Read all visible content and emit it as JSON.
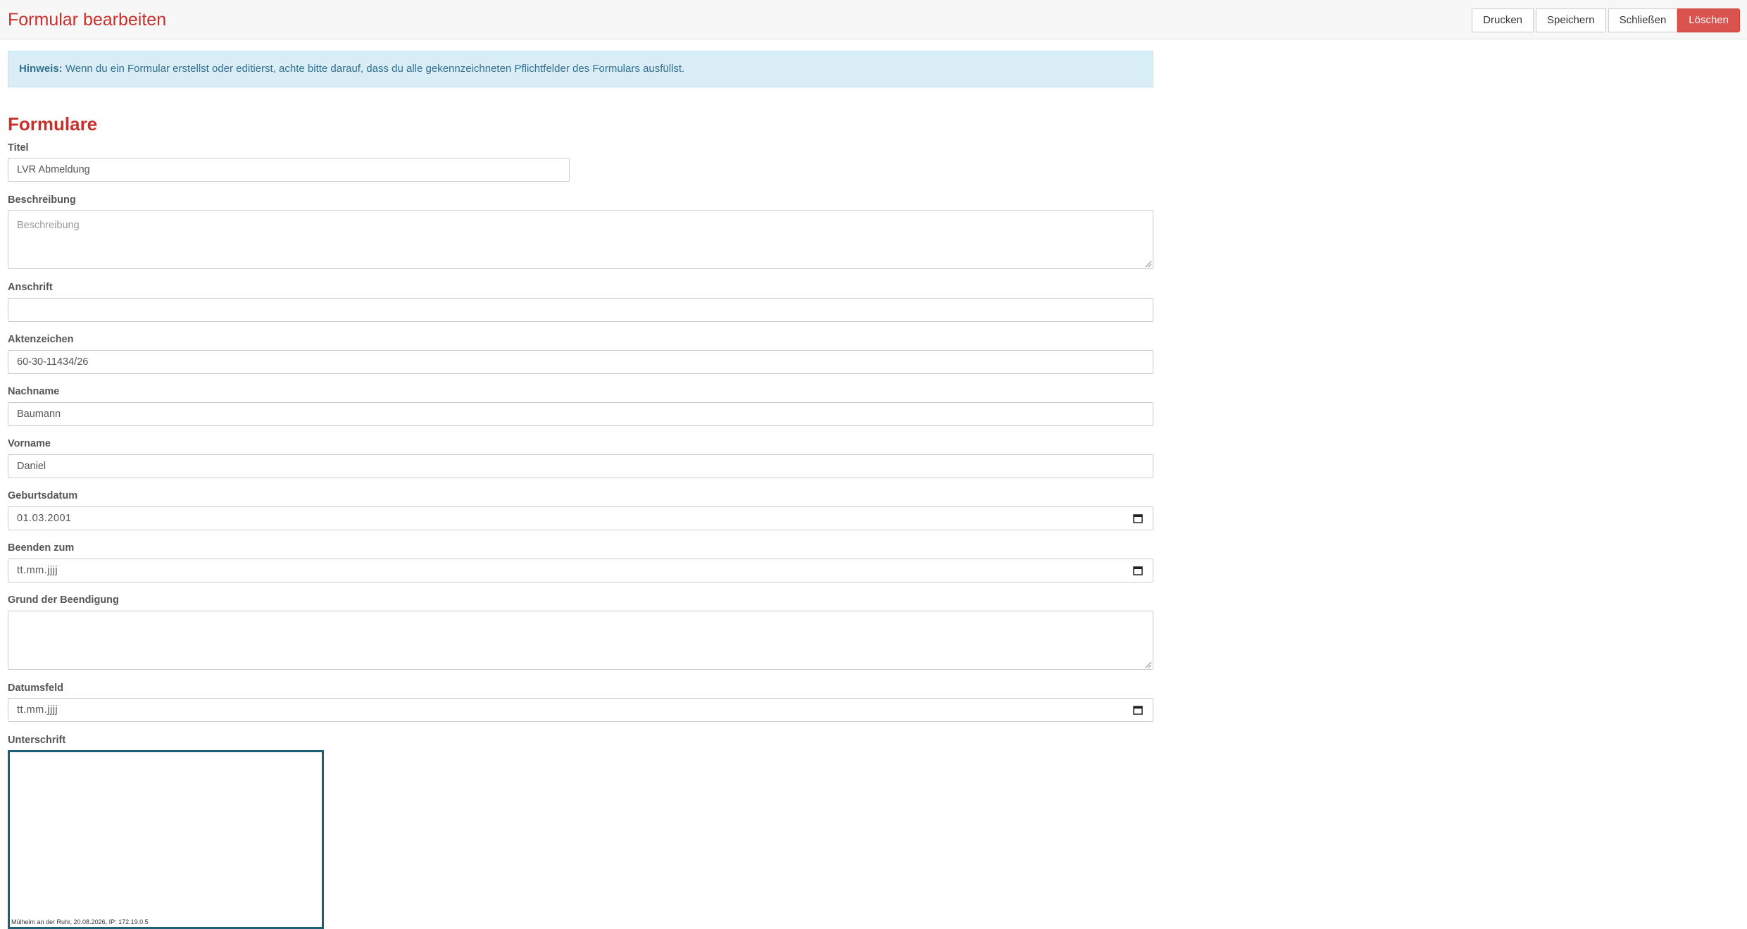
{
  "header": {
    "title": "Formular bearbeiten",
    "buttons": {
      "print": "Drucken",
      "save": "Speichern",
      "close": "Schließen",
      "delete": "Löschen"
    }
  },
  "notice": {
    "label": "Hinweis:",
    "text": " Wenn du ein Formular erstellst oder editierst, achte bitte darauf, dass du alle gekennzeichneten Pflichtfelder des Formulars ausfüllst."
  },
  "form": {
    "section_title": "Formulare",
    "fields": {
      "title": {
        "label": "Titel",
        "value": "LVR Abmeldung"
      },
      "description": {
        "label": "Beschreibung",
        "placeholder": "Beschreibung"
      },
      "address": {
        "label": "Anschrift",
        "value": ""
      },
      "file_number": {
        "label": "Aktenzeichen",
        "value": "60-30-11434/26"
      },
      "last_name": {
        "label": "Nachname",
        "value": "Baumann"
      },
      "first_name": {
        "label": "Vorname",
        "value": "Daniel"
      },
      "birth_date": {
        "label": "Geburtsdatum",
        "value": "01.03.2001"
      },
      "end_date": {
        "label": "Beenden zum",
        "value": "tt.mm.jjjj"
      },
      "end_reason": {
        "label": "Grund der Beendigung",
        "value": ""
      },
      "date_field": {
        "label": "Datumsfeld",
        "value": "tt.mm.jjjj"
      },
      "signature": {
        "label": "Unterschrift",
        "caption": "Mülheim an der Ruhr, 20.08.2026, IP: 172.19.0.5"
      }
    }
  },
  "colors": {
    "accent": "#c9302c",
    "danger": "#d9534f",
    "info_bg": "#d9edf7",
    "info_text": "#31708f",
    "signature_border": "#1f6075"
  },
  "icons": {
    "calendar": "calendar-icon",
    "resize": "resize-grip-icon"
  }
}
